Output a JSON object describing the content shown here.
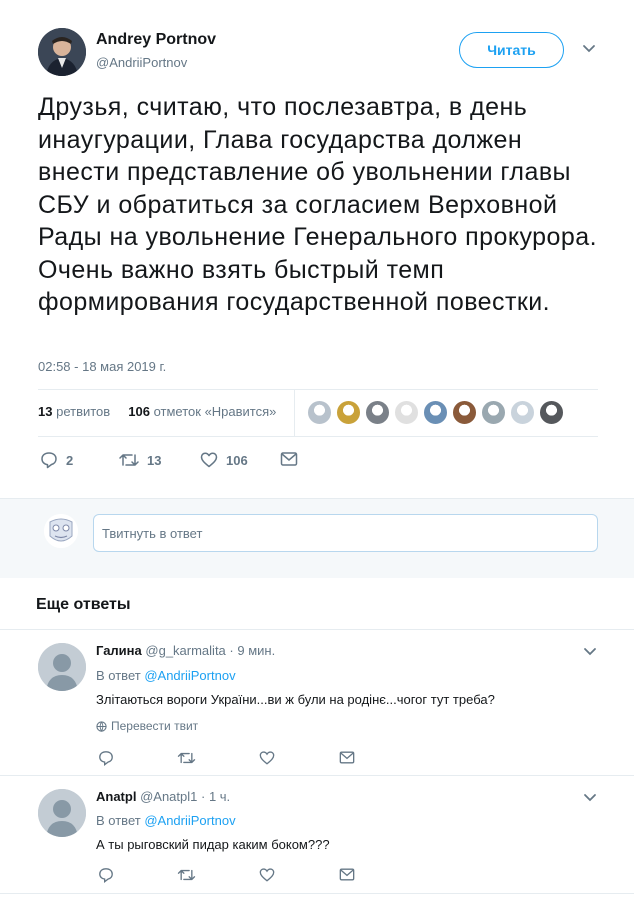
{
  "tweet": {
    "author_name": "Andrey Portnov",
    "author_handle": "@AndriiPortnov",
    "follow_label": "Читать",
    "text": "Друзья, считаю, что послезавтра, в день инаугурации, Глава государства должен внести представление об увольнении главы СБУ и обратиться за согласием Верховной Рады на увольнение Генерального прокурора. Очень важно взять быстрый темп формирования государственной повестки.",
    "timestamp": "02:58 - 18 мая 2019 г.",
    "retweets_count": "13",
    "retweets_label": "ретвитов",
    "likes_count": "106",
    "likes_label": "отметок «Нравится»",
    "likers_colors": [
      "#b8c2cc",
      "#c9a23a",
      "#7a8088",
      "#e0e0e0",
      "#6a8fb5",
      "#8a5a3a",
      "#9aa8b0",
      "#c9d3dc",
      "#55585c"
    ],
    "actions": {
      "replies": "2",
      "retweets": "13",
      "likes": "106"
    }
  },
  "reply_box": {
    "placeholder": "Твитнуть в ответ"
  },
  "more_replies": {
    "title": "Еще ответы"
  },
  "replies": [
    {
      "name": "Галина",
      "handle": "@g_karmalita",
      "time": "· 9 мин.",
      "in_reply_prefix": "В ответ",
      "in_reply_to": "@AndriiPortnov",
      "text": "Злітаються вороги України...ви ж були на родінє...чогог тут треба?",
      "translate": "Перевести твит"
    },
    {
      "name": "Anatpl",
      "handle": "@Anatpl1",
      "time": "· 1 ч.",
      "in_reply_prefix": "В ответ",
      "in_reply_to": "@AndriiPortnov",
      "text": "А ты рыговский пидар каким боком???"
    }
  ]
}
